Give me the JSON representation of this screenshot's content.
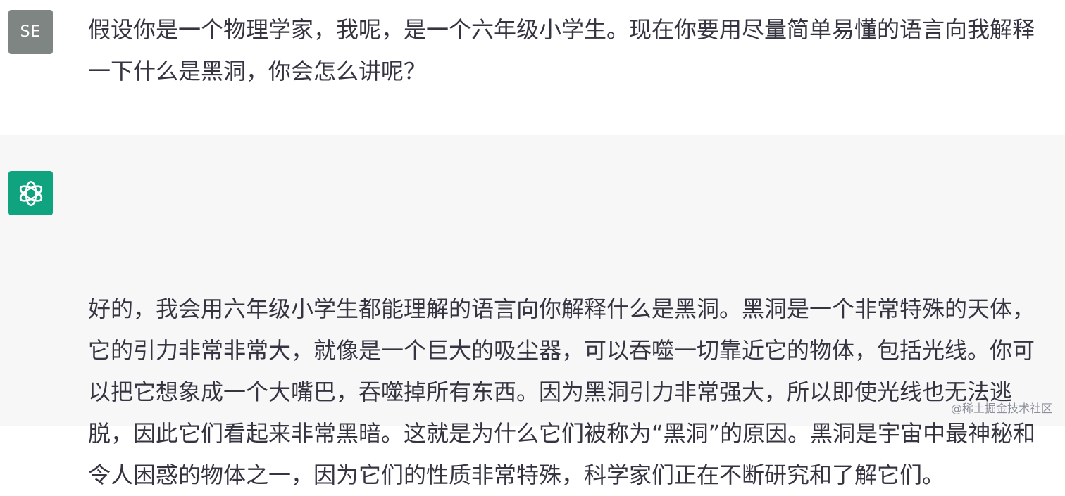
{
  "user_message": {
    "avatar_initials": "SE",
    "text": "假设你是一个物理学家，我呢，是一个六年级小学生。现在你要用尽量简单易懂的语言向我解释一下什么是黑洞，你会怎么讲呢？"
  },
  "assistant_message": {
    "avatar_icon": "openai-logo-icon",
    "text": "好的，我会用六年级小学生都能理解的语言向你解释什么是黑洞。黑洞是一个非常特殊的天体，它的引力非常非常大，就像是一个巨大的吸尘器，可以吞噬一切靠近它的物体，包括光线。你可以把它想象成一个大嘴巴，吞噬掉所有东西。因为黑洞引力非常强大，所以即使光线也无法逃脱，因此它们看起来非常黑暗。这就是为什么它们被称为“黑洞”的原因。黑洞是宇宙中最神秘和令人困惑的物体之一，因为它们的性质非常特殊，科学家们正在不断研究和了解它们。"
  },
  "watermark": "@稀土掘金技术社区",
  "colors": {
    "user_avatar_bg": "#7f8582",
    "assistant_avatar_bg": "#10a37f",
    "assistant_row_bg": "#f7f7f8",
    "text": "#343541"
  }
}
